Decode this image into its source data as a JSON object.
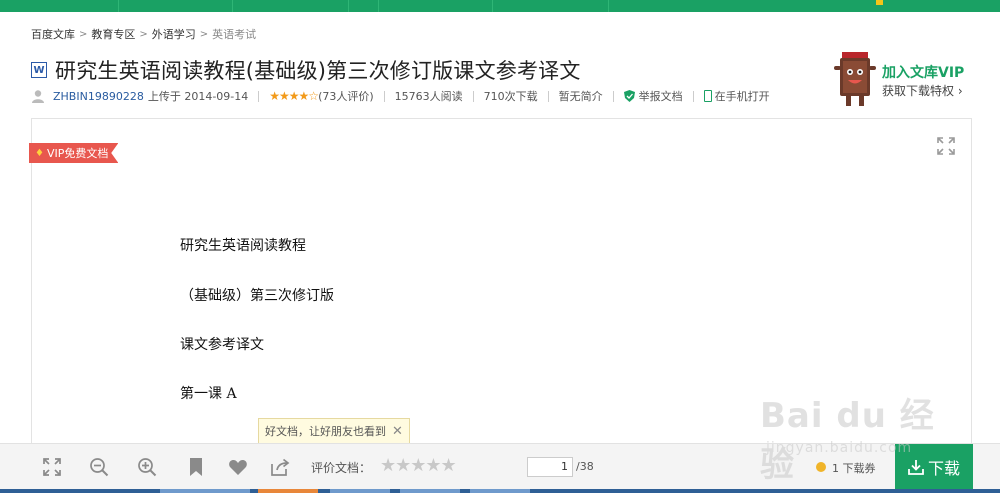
{
  "breadcrumb": [
    "百度文库",
    "教育专区",
    "外语学习",
    "英语考试"
  ],
  "document": {
    "format_icon_letter": "W",
    "title": "研究生英语阅读教程(基础级)第三次修订版课文参考译文"
  },
  "meta": {
    "uploader": "ZHBIN19890228",
    "uploaded_on": "上传于 2014-09-14",
    "rating_stars": "★★★★☆",
    "rating_count": "(73人评价)",
    "views": "15763人阅读",
    "downloads": "710次下载",
    "summary": "暂无简介",
    "report": "举报文档",
    "open_mobile": "在手机打开"
  },
  "vip_promo": {
    "title": "加入文库VIP",
    "subtitle": "获取下载特权 ›"
  },
  "viewer": {
    "vip_badge": "VIP免费文档",
    "lines": [
      "研究生英语阅读教程",
      "（基础级）第三次修订版",
      "课文参考译文",
      "第一课  A"
    ]
  },
  "tooltip": {
    "text": "好文档，让好朋友也看到",
    "close": "✕"
  },
  "toolbar": {
    "rate_label": "评价文档：",
    "rate_stars": "★★★★★",
    "current_page": "1",
    "total_pages": "/38",
    "voucher": "1 下载券",
    "download_label": "下载"
  },
  "watermark": {
    "brand": "Bai du 经验",
    "url": "jingyan.baidu.com"
  },
  "colors": {
    "brand_green": "#1aa164",
    "vip_red": "#e8574e",
    "star_orange": "#f29a1a"
  }
}
